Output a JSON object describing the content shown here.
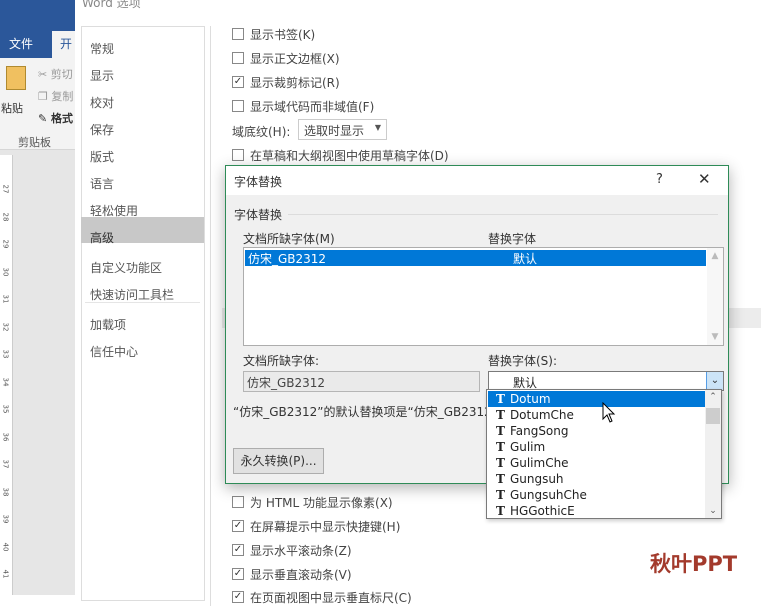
{
  "word": {
    "tab_file": "文件",
    "tab_home": "开",
    "ribbon": {
      "paste": "粘贴",
      "cut": "剪切",
      "copy": "复制",
      "format": "格式",
      "clipboard": "剪贴板"
    },
    "ruler": [
      "27",
      "28",
      "29",
      "30",
      "31",
      "32",
      "33",
      "34",
      "35",
      "36",
      "37",
      "38",
      "39",
      "40",
      "41"
    ]
  },
  "options": {
    "title": "Word 选项",
    "sidebar": [
      "常规",
      "显示",
      "校对",
      "保存",
      "版式",
      "语言",
      "轻松使用",
      "高级",
      "自定义功能区",
      "快速访问工具栏",
      "加载项",
      "信任中心"
    ],
    "selected": "高级",
    "top_options": [
      {
        "label": "显示书签(K)",
        "checked": false
      },
      {
        "label": "显示正文边框(X)",
        "checked": false
      },
      {
        "label": "显示裁剪标记(R)",
        "checked": true
      },
      {
        "label": "显示域代码而非域值(F)",
        "checked": false
      }
    ],
    "field_shading_label": "域底纹(H):",
    "field_shading_value": "选取时显示",
    "draft_font": {
      "label": "在草稿和大纲视图中使用草稿字体(D)",
      "checked": false
    },
    "bottom_options": [
      {
        "label": "为 HTML 功能显示像素(X)",
        "checked": false
      },
      {
        "label": "在屏幕提示中显示快捷键(H)",
        "checked": true
      },
      {
        "label": "显示水平滚动条(Z)",
        "checked": true
      },
      {
        "label": "显示垂直滚动条(V)",
        "checked": true
      },
      {
        "label": "在页面视图中显示垂直标尺(C)",
        "checked": true
      }
    ]
  },
  "dialog": {
    "title": "字体替换",
    "help": "?",
    "close": "✕",
    "group": "字体替换",
    "col_missing": "文档所缺字体(M)",
    "col_sub": "替换字体",
    "rows": [
      {
        "missing": "仿宋_GB2312",
        "sub": "默认"
      }
    ],
    "missing_label": "文档所缺字体:",
    "sub_label": "替换字体(S):",
    "missing_value": "仿宋_GB2312",
    "sub_value": "默认",
    "message": "“仿宋_GB2312”的默认替换项是“仿宋_GB2312”。",
    "perm_button": "永久转换(P)...",
    "font_options": [
      "Dotum",
      "DotumChe",
      "FangSong",
      "Gulim",
      "GulimChe",
      "Gungsuh",
      "GungsuhChe",
      "HGGothicE"
    ],
    "font_selected": "Dotum"
  },
  "watermark": "秋叶PPT",
  "colors": {
    "word_blue": "#2b579a",
    "select_blue": "#0078d7",
    "dialog_border": "#2e8b57",
    "watermark": "#a33a2c"
  }
}
